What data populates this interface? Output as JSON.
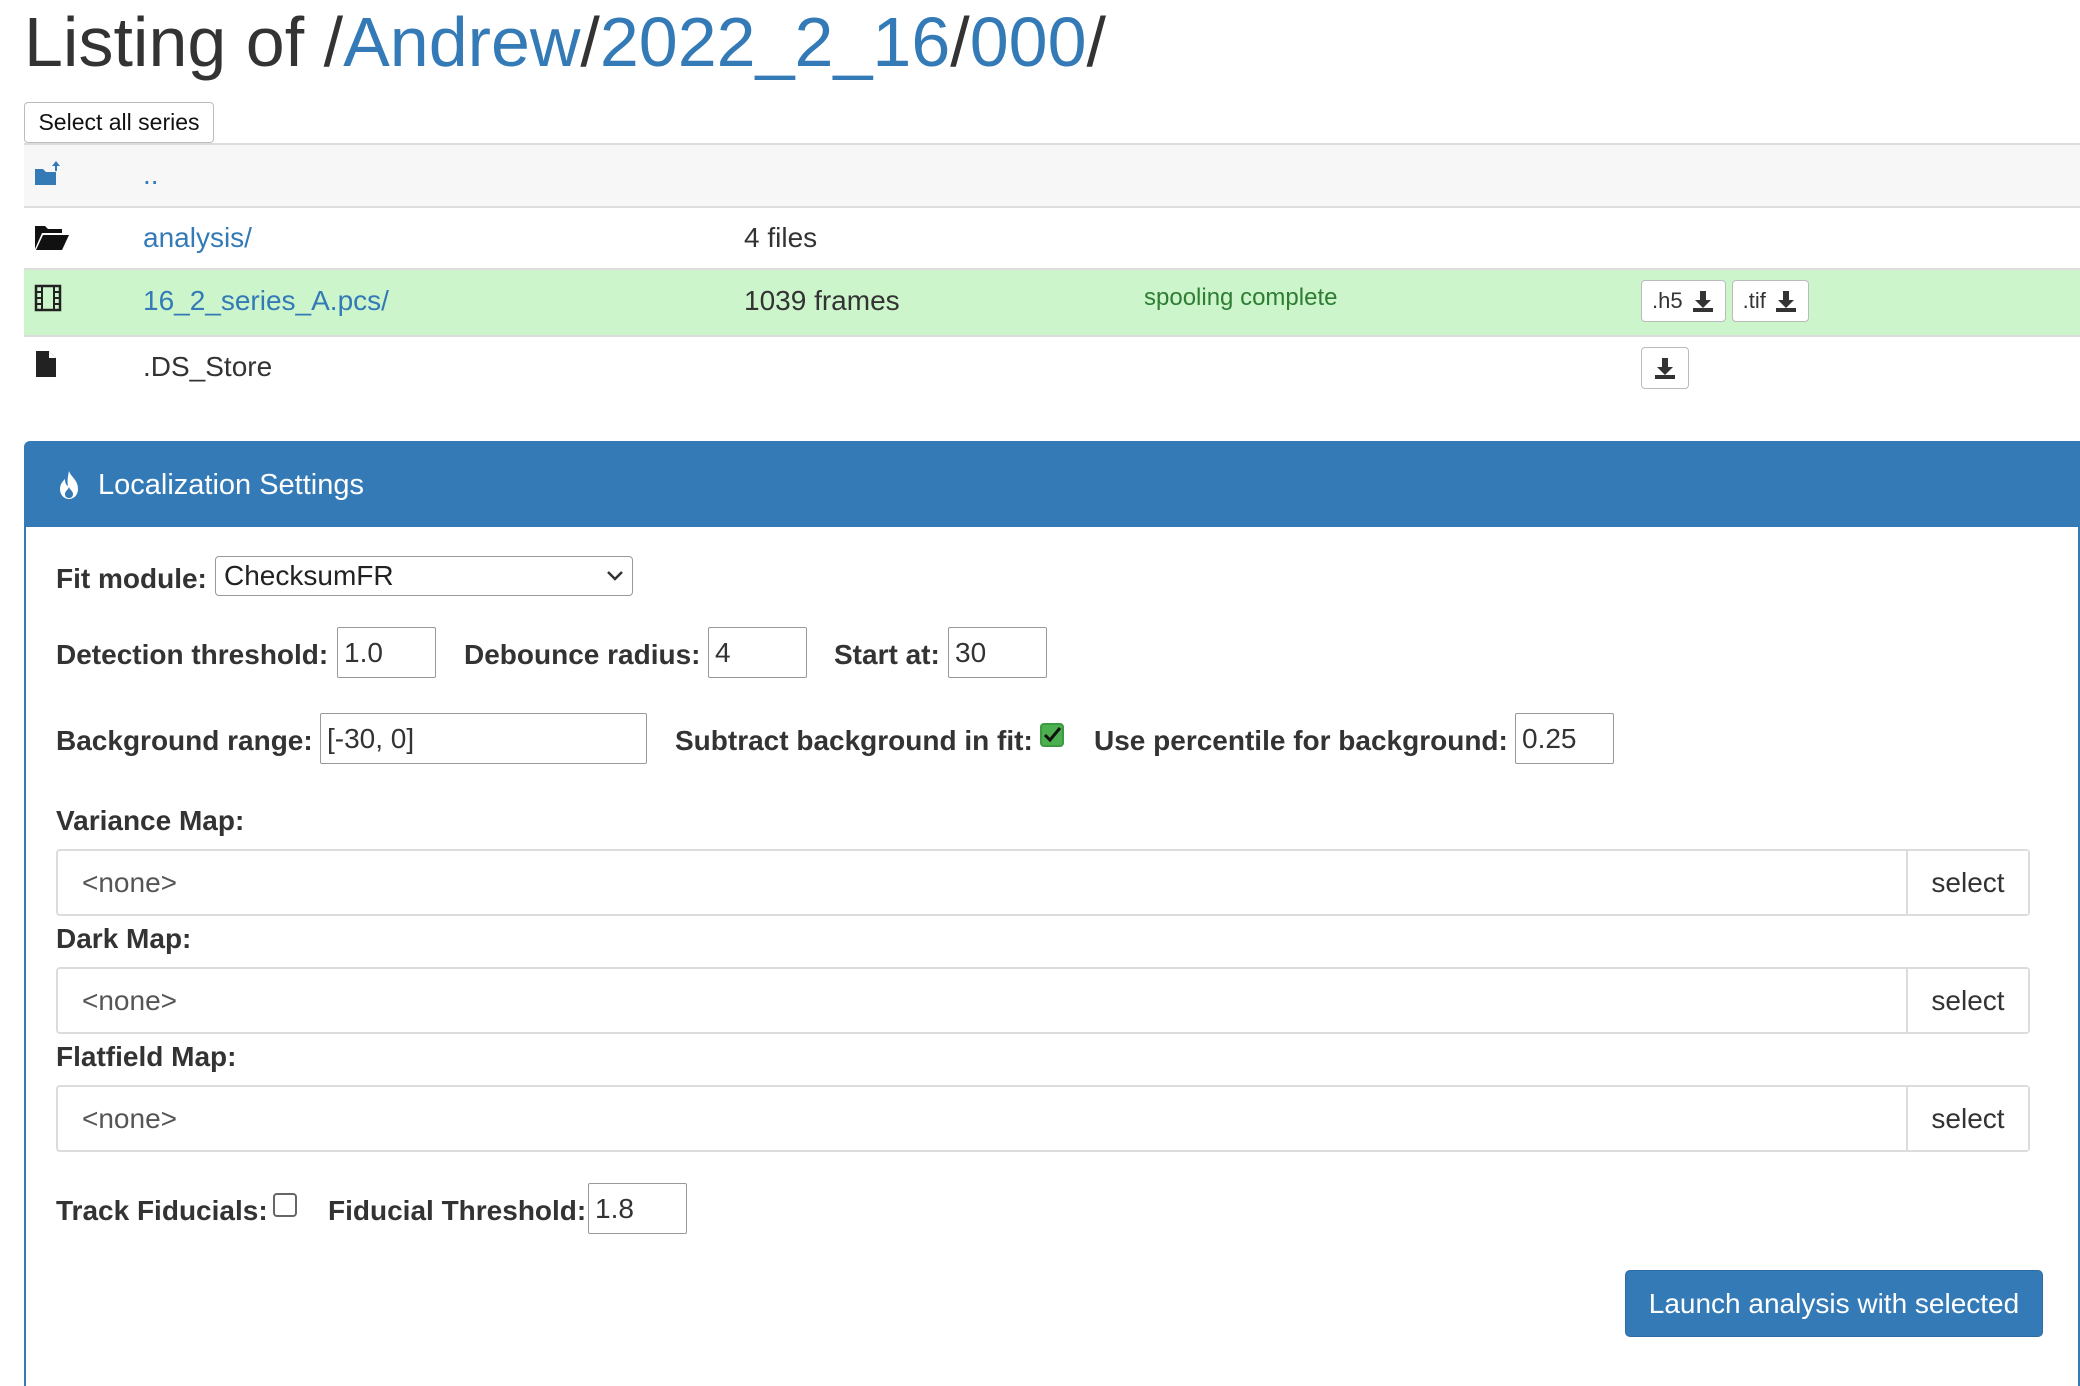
{
  "title": {
    "prefix": "Listing of /",
    "crumbs": [
      "Andrew",
      "2022_2_16",
      "000"
    ],
    "separator": "/"
  },
  "select_all_label": "Select all series",
  "listing": {
    "parent": {
      "name": "..",
      "icon": "folder-up-icon"
    },
    "rows": [
      {
        "icon": "folder-open-icon",
        "name": "analysis/",
        "count": "4 files",
        "status": ""
      },
      {
        "icon": "film-icon",
        "name": "16_2_series_A.pcs/",
        "count": "1039 frames",
        "status": "spooling complete",
        "downloads": [
          ".h5",
          ".tif"
        ]
      },
      {
        "icon": "file-icon",
        "name": ".DS_Store",
        "count": "",
        "status": ""
      }
    ]
  },
  "panel": {
    "title": "Localization Settings",
    "fit_module": {
      "label": "Fit module:",
      "value": "ChecksumFR"
    },
    "detection_threshold": {
      "label": "Detection threshold:",
      "value": "1.0"
    },
    "debounce_radius": {
      "label": "Debounce radius:",
      "value": "4"
    },
    "start_at": {
      "label": "Start at:",
      "value": "30"
    },
    "background_range": {
      "label": "Background range:",
      "value": "[-30, 0]"
    },
    "subtract_background": {
      "label": "Subtract background in fit:",
      "checked": true
    },
    "percentile_background": {
      "label": "Use percentile for background:",
      "value": "0.25"
    },
    "variance_map": {
      "label": "Variance Map:",
      "value": "<none>",
      "button": "select"
    },
    "dark_map": {
      "label": "Dark Map:",
      "value": "<none>",
      "button": "select"
    },
    "flatfield_map": {
      "label": "Flatfield Map:",
      "value": "<none>",
      "button": "select"
    },
    "track_fiducials": {
      "label": "Track Fiducials:",
      "checked": false
    },
    "fiducial_threshold": {
      "label": "Fiducial Threshold:",
      "value": "1.8"
    },
    "launch_label": "Launch analysis with selected"
  },
  "colors": {
    "accent": "#337ab7",
    "series_row_bg": "#ccf5cc",
    "status_text": "#2e7d32"
  }
}
